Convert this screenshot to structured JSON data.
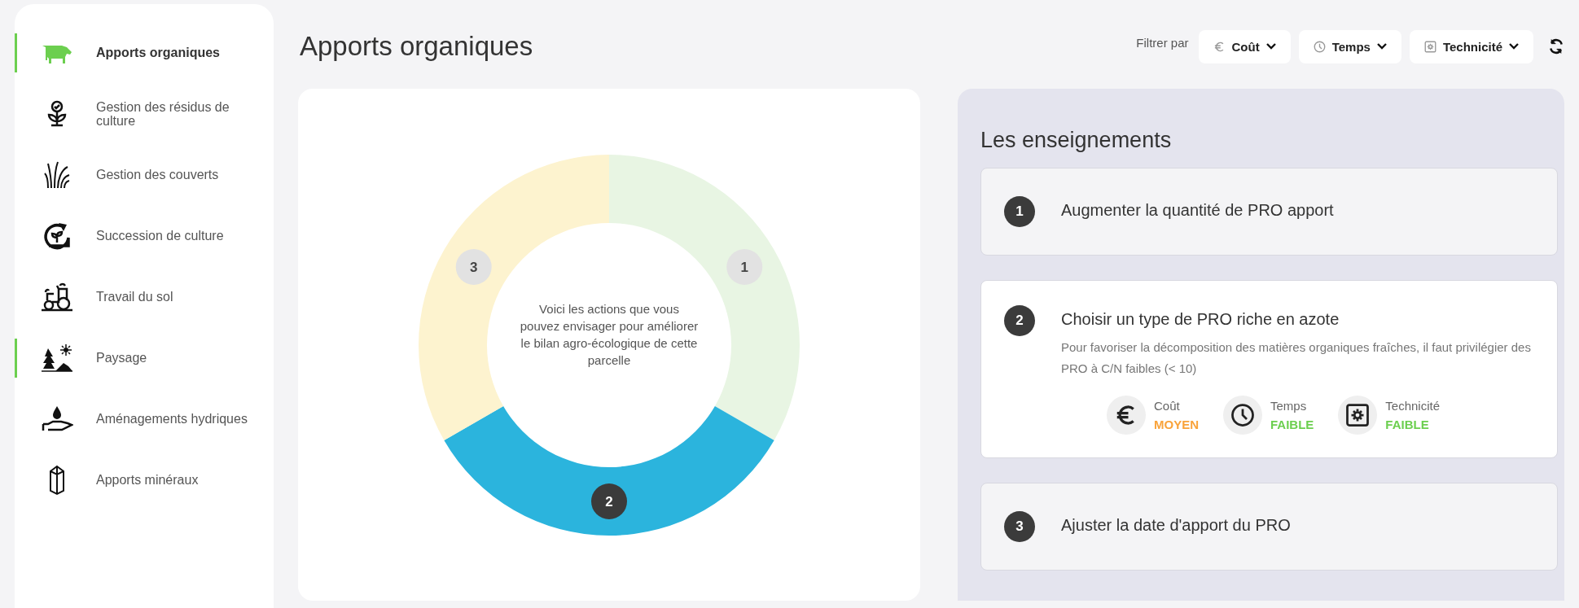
{
  "sidebar": {
    "items": [
      {
        "label": "Apports organiques",
        "selected": true,
        "accent": true
      },
      {
        "label": "Gestion des résidus de culture",
        "selected": false,
        "accent": false
      },
      {
        "label": "Gestion des couverts",
        "selected": false,
        "accent": false
      },
      {
        "label": "Succession de culture",
        "selected": false,
        "accent": false
      },
      {
        "label": "Travail du sol",
        "selected": false,
        "accent": false
      },
      {
        "label": "Paysage",
        "selected": false,
        "accent": true
      },
      {
        "label": "Aménagements hydriques",
        "selected": false,
        "accent": false
      },
      {
        "label": "Apports minéraux",
        "selected": false,
        "accent": false
      }
    ]
  },
  "header": {
    "title": "Apports organiques",
    "filter_label": "Filtrer par",
    "filters": [
      {
        "label": "Coût",
        "kind": "euro"
      },
      {
        "label": "Temps",
        "kind": "clock"
      },
      {
        "label": "Technicité",
        "kind": "gear"
      }
    ]
  },
  "donut": {
    "center_text": "Voici les actions que vous pouvez envisager pour améliorer le bilan agro-écologique de cette parcelle",
    "segments": [
      {
        "label": "1",
        "color": "#e8f5e3",
        "selected": false
      },
      {
        "label": "2",
        "color": "#2bb4dd",
        "selected": true
      },
      {
        "label": "3",
        "color": "#fdf3cf",
        "selected": false
      }
    ]
  },
  "lessons": {
    "title": "Les enseignements",
    "items": [
      {
        "number": "1",
        "title": "Augmenter la quantité de PRO apport",
        "expanded": false
      },
      {
        "number": "2",
        "title": "Choisir un type de PRO riche en azote",
        "expanded": true,
        "description": "Pour favoriser la décomposition des matières organiques fraîches, il faut privilégier des PRO à C/N faibles (< 10)",
        "criteria": [
          {
            "kind": "euro",
            "label": "Coût",
            "value": "MOYEN",
            "color": "#f9a33a"
          },
          {
            "kind": "clock",
            "label": "Temps",
            "value": "FAIBLE",
            "color": "#6ccf4f"
          },
          {
            "kind": "gear",
            "label": "Technicité",
            "value": "FAIBLE",
            "color": "#6ccf4f"
          }
        ]
      },
      {
        "number": "3",
        "title": "Ajuster la date d'apport du PRO",
        "expanded": false
      }
    ]
  }
}
